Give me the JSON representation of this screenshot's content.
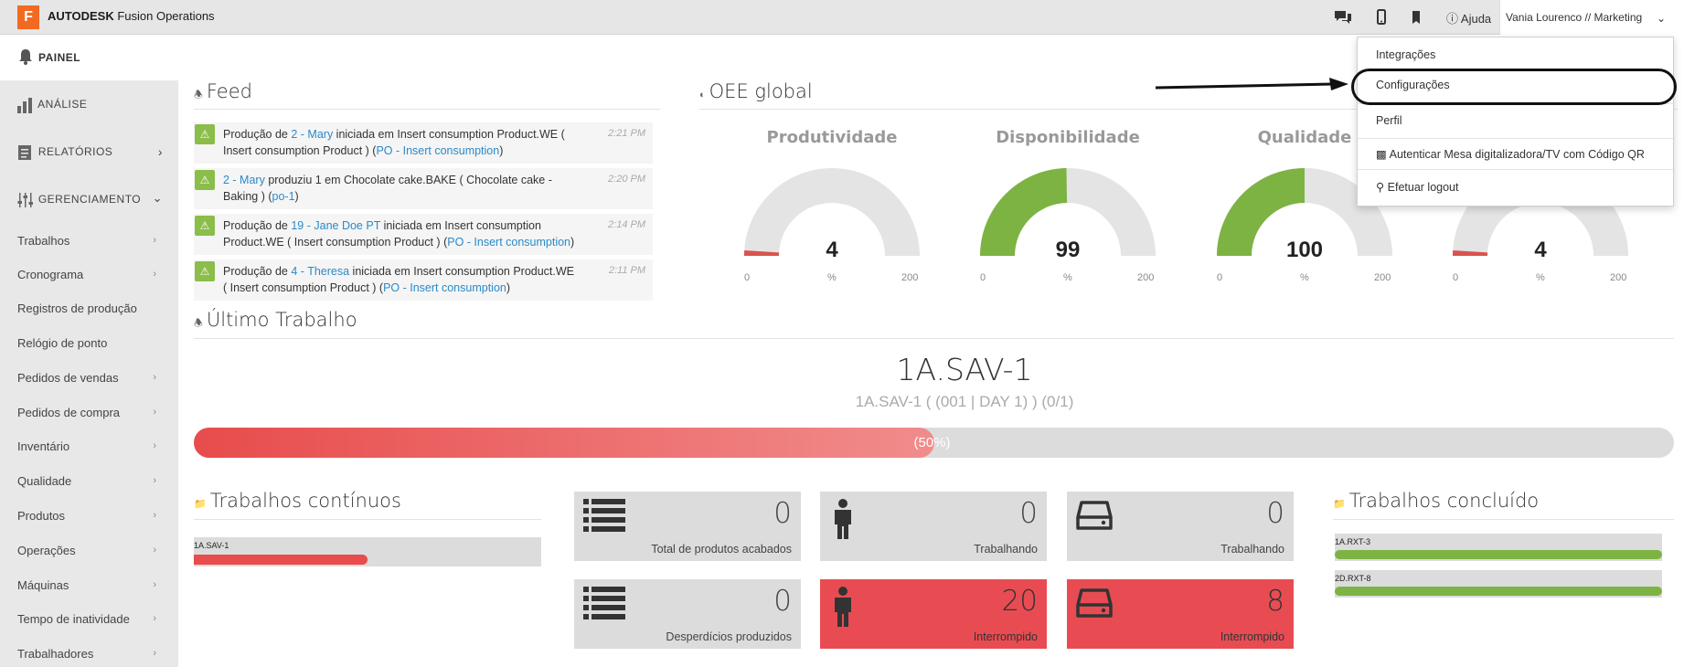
{
  "app": {
    "logo_letter": "F",
    "brand_bold": "AUTODESK",
    "brand_rest": " Fusion Operations"
  },
  "topbar": {
    "help_label": "Ajuda",
    "user_label": "Vania Lourenco // Marketing"
  },
  "sidebar": {
    "header_label": "PAINEL",
    "sections": [
      {
        "label": "ANÁLISE"
      },
      {
        "label": "RELATÓRIOS"
      },
      {
        "label": "GERENCIAMENTO"
      }
    ],
    "items": [
      {
        "label": "Trabalhos"
      },
      {
        "label": "Cronograma"
      },
      {
        "label": "Registros de produção"
      },
      {
        "label": "Relógio de ponto"
      },
      {
        "label": "Pedidos de vendas"
      },
      {
        "label": "Pedidos de compra"
      },
      {
        "label": "Inventário"
      },
      {
        "label": "Qualidade"
      },
      {
        "label": "Produtos"
      },
      {
        "label": "Operações"
      },
      {
        "label": "Máquinas"
      },
      {
        "label": "Tempo de inatividade"
      },
      {
        "label": "Trabalhadores"
      }
    ]
  },
  "feed": {
    "title": "Feed",
    "items": [
      {
        "p1": "Produção de ",
        "l1": "2 - Mary",
        "p2": " iniciada em Insert consumption Product.WE ( Insert consumption Product ) (",
        "l2": "PO - Insert consumption",
        "p3": ")",
        "time": "2:21 PM"
      },
      {
        "p1": "",
        "l1": "2 - Mary",
        "p2": " produziu 1 em Chocolate cake.BAKE ( Chocolate cake - Baking ) (",
        "l2": "po-1",
        "p3": ")",
        "time": "2:20 PM"
      },
      {
        "p1": "Produção de ",
        "l1": "19 - Jane Doe PT",
        "p2": " iniciada em Insert consumption Product.WE ( Insert consumption Product ) (",
        "l2": "PO - Insert consumption",
        "p3": ")",
        "time": "2:14 PM"
      },
      {
        "p1": "Produção de ",
        "l1": "4 - Theresa",
        "p2": " iniciada em Insert consumption Product.WE ( Insert consumption Product ) (",
        "l2": "PO - Insert consumption",
        "p3": ")",
        "time": "2:11 PM"
      }
    ]
  },
  "oee": {
    "title": "OEE global",
    "gauges": [
      {
        "title": "Produtividade",
        "value": "4",
        "unit": "%",
        "min": "0",
        "max": "200",
        "fraction": 0.02,
        "color": "#d9534f"
      },
      {
        "title": "Disponibilidade",
        "value": "99",
        "unit": "%",
        "min": "0",
        "max": "200",
        "fraction": 0.495,
        "color": "#7cb342"
      },
      {
        "title": "Qualidade",
        "value": "100",
        "unit": "%",
        "min": "0",
        "max": "200",
        "fraction": 0.5,
        "color": "#7cb342"
      },
      {
        "title": "",
        "value": "4",
        "unit": "%",
        "min": "0",
        "max": "200",
        "fraction": 0.02,
        "color": "#d9534f"
      }
    ]
  },
  "last_job": {
    "title": "Último Trabalho",
    "code": "1A.SAV-1",
    "subtitle": "1A.SAV-1 ( (001 | DAY 1) ) (0/1)",
    "progress_label": "(50%)",
    "progress": 0.5
  },
  "continuous": {
    "title": "Trabalhos contínuos",
    "items": [
      {
        "label": "1A.SAV-1",
        "progress": 0.5,
        "color": "#e84c4c"
      }
    ]
  },
  "completed": {
    "title": "Trabalhos concluído",
    "items": [
      {
        "label": "1A.RXT-3",
        "progress": 1.0,
        "color": "#7cb342"
      },
      {
        "label": "2D.RXT-8",
        "progress": 1.0,
        "color": "#7cb342"
      }
    ]
  },
  "tiles": [
    {
      "value": "0",
      "label": "Total de produtos acabados",
      "icon": "list-icon"
    },
    {
      "value": "0",
      "label": "Trabalhando",
      "icon": "person-icon"
    },
    {
      "value": "0",
      "label": "Trabalhando",
      "icon": "machine-icon"
    },
    {
      "value": "0",
      "label": "Desperdícios produzidos",
      "icon": "list-icon"
    },
    {
      "value": "20",
      "label": "Interrompido",
      "icon": "person-icon"
    },
    {
      "value": "8",
      "label": "Interrompido",
      "icon": "machine-icon"
    }
  ],
  "dropdown": {
    "items": [
      {
        "label": "Integrações"
      },
      {
        "label": "Configurações"
      },
      {
        "label": "Perfil"
      },
      {
        "label": "Autenticar Mesa digitalizadora/TV com Código QR"
      },
      {
        "label": "Efetuar logout"
      }
    ]
  }
}
